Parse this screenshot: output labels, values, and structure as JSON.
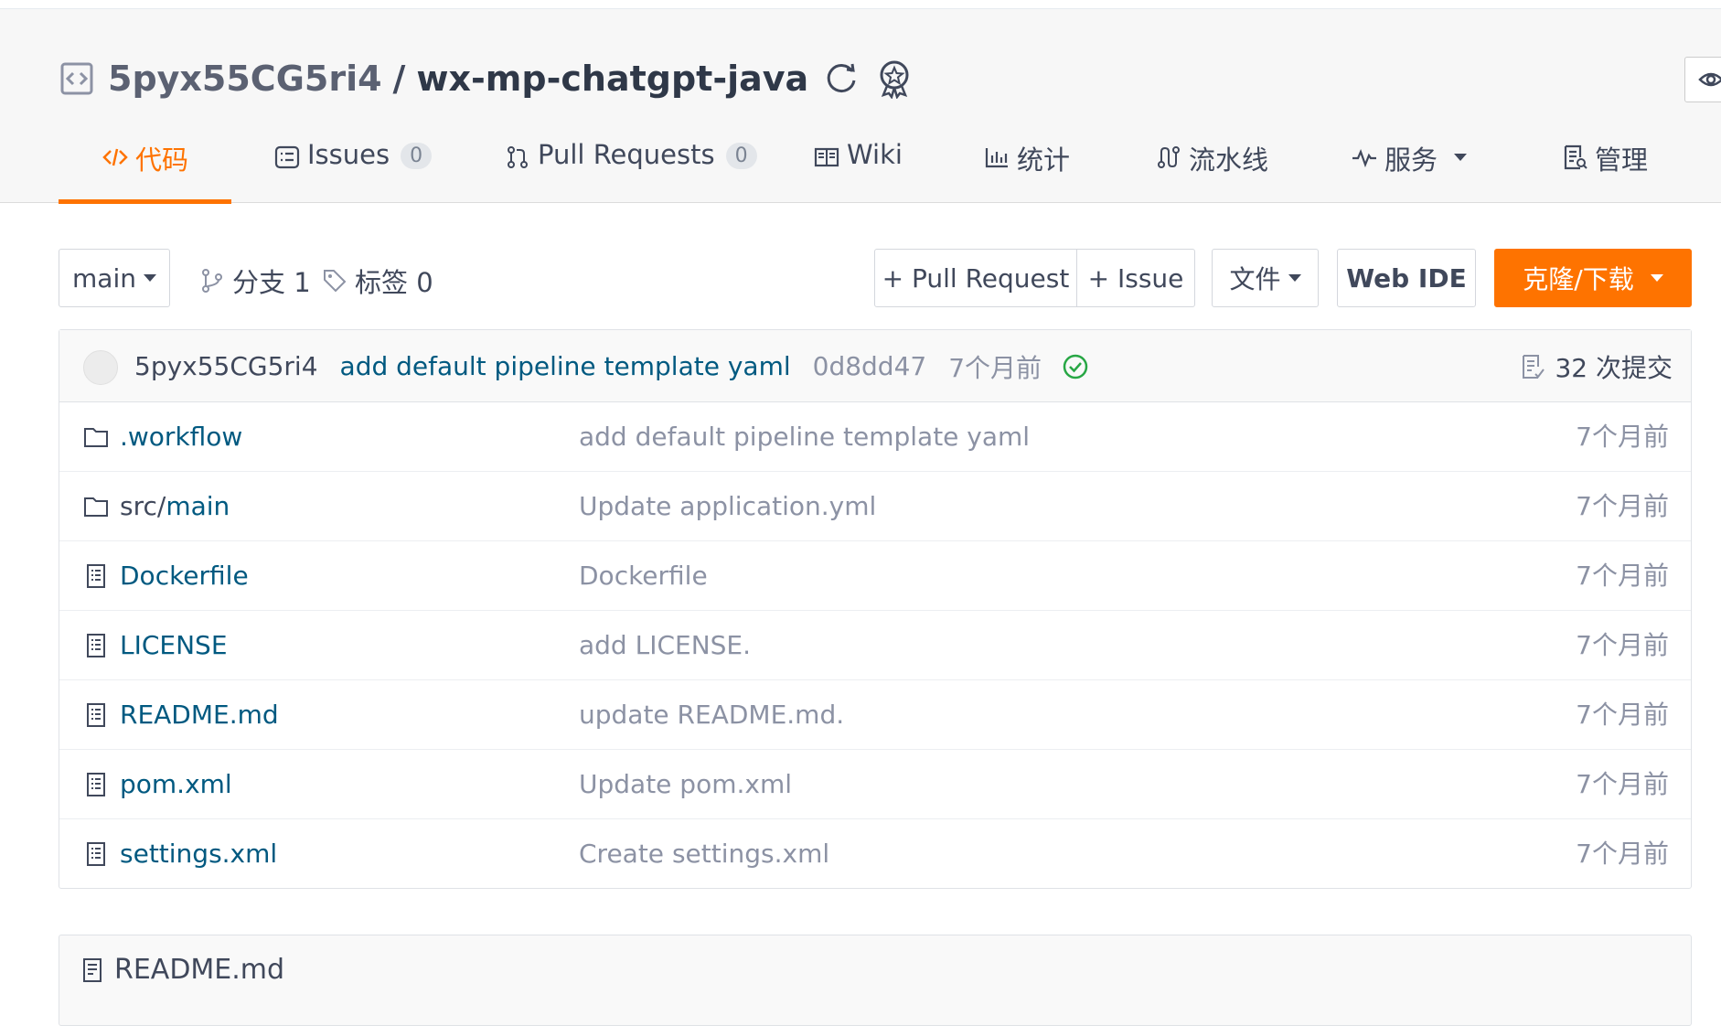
{
  "repo": {
    "owner": "5pyx55CG5ri4",
    "separator": "/",
    "name": "wx-mp-chatgpt-java"
  },
  "tabs": [
    {
      "label": "代码",
      "icon": "code-icon",
      "active": true
    },
    {
      "label": "Issues",
      "count": "0",
      "icon": "issues-icon"
    },
    {
      "label": "Pull Requests",
      "count": "0",
      "icon": "pull-request-icon"
    },
    {
      "label": "Wiki",
      "icon": "wiki-icon"
    },
    {
      "label": "统计",
      "icon": "stats-icon"
    },
    {
      "label": "流水线",
      "icon": "pipeline-icon"
    },
    {
      "label": "服务",
      "icon": "service-icon",
      "dropdown": true
    },
    {
      "label": "管理",
      "icon": "manage-icon"
    }
  ],
  "toolbar": {
    "branch": "main",
    "branches": "分支 1",
    "tags": "标签 0",
    "pull_request": "+ Pull Request",
    "issue": "+ Issue",
    "file": "文件",
    "web_ide": "Web IDE",
    "clone": "克隆/下载"
  },
  "commit": {
    "author": "5pyx55CG5ri4",
    "message": "add default pipeline template yaml",
    "sha": "0d8dd47",
    "time": "7个月前",
    "status": "success",
    "count": "32 次提交"
  },
  "files": [
    {
      "name": ".workflow",
      "type": "folder",
      "message": "add default pipeline template yaml",
      "time": "7个月前"
    },
    {
      "name_plain": "src/",
      "name_link": "main",
      "type": "folder",
      "message": "Update application.yml",
      "time": "7个月前"
    },
    {
      "name": "Dockerfile",
      "type": "file",
      "message": "Dockerfile",
      "time": "7个月前"
    },
    {
      "name": "LICENSE",
      "type": "file",
      "message": "add LICENSE.",
      "time": "7个月前"
    },
    {
      "name": "README.md",
      "type": "file",
      "message": "update README.md.",
      "time": "7个月前"
    },
    {
      "name": "pom.xml",
      "type": "file",
      "message": "Update pom.xml",
      "time": "7个月前"
    },
    {
      "name": "settings.xml",
      "type": "file",
      "message": "Create settings.xml",
      "time": "7个月前"
    }
  ],
  "readme": {
    "title": "README.md"
  },
  "colors": {
    "accent": "#fe7300",
    "link": "#005980",
    "muted": "#8c92a4",
    "success": "#28a745"
  }
}
